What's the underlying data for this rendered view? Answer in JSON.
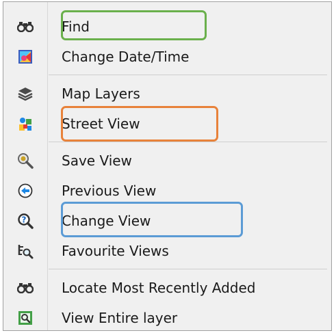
{
  "menu": {
    "items": [
      {
        "label": "Find",
        "icon": "binoculars-icon"
      },
      {
        "label": "Change Date/Time",
        "icon": "calendar-color-icon"
      },
      {
        "label": "Map Layers",
        "icon": "layers-icon"
      },
      {
        "label": "Street View",
        "icon": "street-view-icon"
      },
      {
        "label": "Save View",
        "icon": "save-view-magnifier-icon"
      },
      {
        "label": "Previous View",
        "icon": "back-arrow-circle-icon"
      },
      {
        "label": "Change View",
        "icon": "change-view-magnifier-icon"
      },
      {
        "label": "Favourite Views",
        "icon": "favourite-views-icon"
      },
      {
        "label": "Locate Most Recently Added",
        "icon": "binoculars-icon"
      },
      {
        "label": "View Entire layer",
        "icon": "view-entire-layer-icon"
      }
    ]
  },
  "highlights": {
    "find": "#6ab04c",
    "street_view": "#e8823a",
    "change_view": "#5b9bd5"
  }
}
